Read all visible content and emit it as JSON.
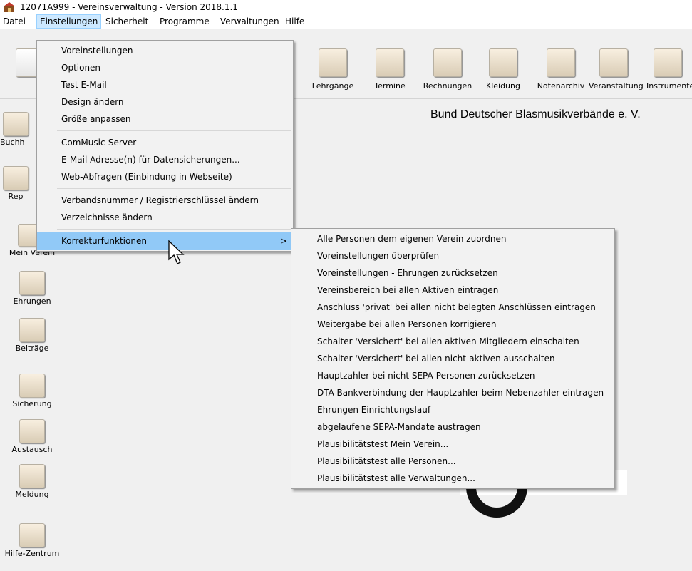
{
  "window": {
    "title": "12071A999 - Vereinsverwaltung - Version 2018.1.1"
  },
  "menubar": {
    "items": [
      "Datei",
      "Einstellungen",
      "Sicherheit",
      "Programme",
      "Verwaltungen",
      "Hilfe"
    ],
    "active": "Einstellungen"
  },
  "toolbar": {
    "items": [
      "Lehrgänge",
      "Termine",
      "Rechnungen",
      "Kleidung",
      "Notenarchiv",
      "Veranstaltung",
      "Instrumente"
    ]
  },
  "sidebar": {
    "items": [
      "Buchh",
      "Rep",
      "Mein Verein",
      "Ehrungen",
      "Beiträge",
      "Sicherung",
      "Austausch",
      "Meldung",
      "Hilfe-Zentrum"
    ]
  },
  "main": {
    "organization": "Bund Deutscher Blasmusikverbände e. V."
  },
  "menu_einstellungen": {
    "items": [
      "Voreinstellungen",
      "Optionen",
      "Test E-Mail",
      "Design ändern",
      "Größe anpassen",
      "ComMusic-Server",
      "E-Mail Adresse(n) für Datensicherungen...",
      "Web-Abfragen (Einbindung in Webseite)",
      "Verbandsnummer / Registrierschlüssel ändern",
      "Verzeichnisse ändern",
      "Korrekturfunktionen"
    ],
    "submenu_arrow": ">"
  },
  "submenu_korrektur": {
    "items": [
      "Alle Personen dem eigenen Verein zuordnen",
      "Voreinstellungen überprüfen",
      "Voreinstellungen - Ehrungen zurücksetzen",
      "Vereinsbereich bei allen Aktiven eintragen",
      "Anschluss 'privat' bei allen nicht belegten Anschlüssen eintragen",
      "Weitergabe bei allen Personen korrigieren",
      "Schalter 'Versichert' bei allen aktiven Mitgliedern einschalten",
      "Schalter 'Versichert' bei allen nicht-aktiven ausschalten",
      "Hauptzahler bei nicht SEPA-Personen zurücksetzen",
      "DTA-Bankverbindung der Hauptzahler beim Nebenzahler eintragen",
      "Ehrungen Einrichtungslauf",
      "abgelaufene SEPA-Mandate austragen",
      "Plausibilitätstest Mein Verein...",
      "Plausibilitätstest alle Personen...",
      "Plausibilitätstest alle Verwaltungen..."
    ]
  },
  "colors": {
    "highlight": "#91c9f7",
    "menubar_active": "#cce8ff"
  }
}
